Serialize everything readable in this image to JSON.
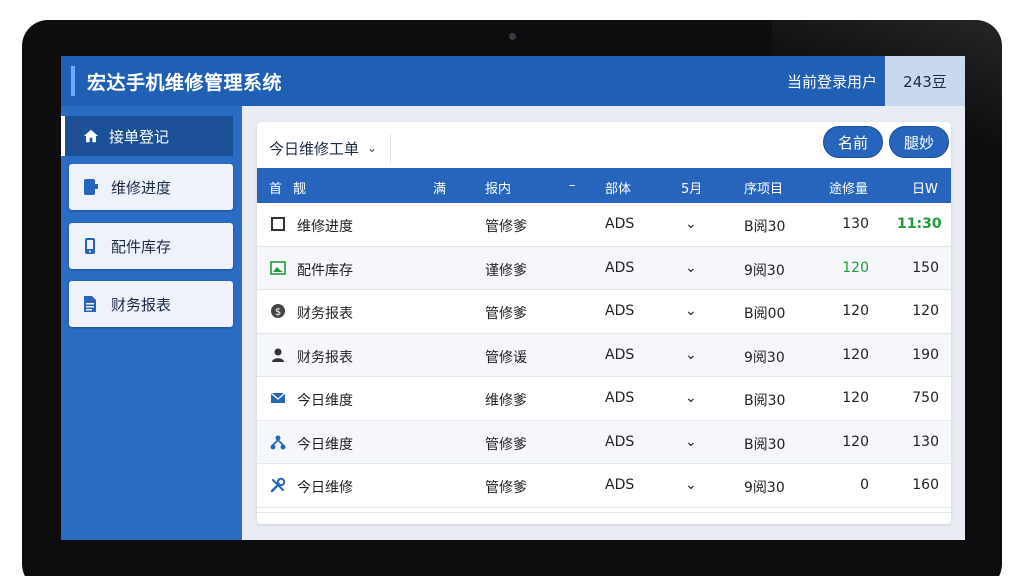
{
  "app": {
    "title": "宏达手机维修管理系统",
    "user_label": "当前登录用户",
    "user_value": "243豆"
  },
  "sidebar": {
    "items": [
      {
        "label": "接单登记",
        "icon": "home-icon"
      },
      {
        "label": "维修进度",
        "icon": "phone-icon"
      },
      {
        "label": "配件库存",
        "icon": "mobile-icon"
      },
      {
        "label": "财务报表",
        "icon": "document-icon"
      }
    ]
  },
  "toolbar": {
    "dropdown_value": "今日维修工单",
    "button_1": "名前",
    "button_2": "腿妙"
  },
  "table": {
    "headers": [
      "首",
      "靓",
      "满",
      "报内",
      "–",
      "部体",
      "5月",
      "序项目",
      "途修量",
      "日W"
    ],
    "rows": [
      {
        "icon": "square-icon",
        "name": "维修进度",
        "col3": "管修爹",
        "col4": "ADS",
        "col5": "⌄",
        "col6": "B阅30",
        "col7": "130",
        "col8": "11:30"
      },
      {
        "icon": "image-icon",
        "name": "配件库存",
        "col3": "谨修爹",
        "col4": "ADS",
        "col5": "⌄",
        "col6": "9阅30",
        "col7": "120",
        "col8": "150"
      },
      {
        "icon": "coin-icon",
        "name": "财务报表",
        "col3": "管修爹",
        "col4": "ADS",
        "col5": "⌄",
        "col6": "B阅00",
        "col7": "120",
        "col8": "120"
      },
      {
        "icon": "user-icon",
        "name": "财务报表",
        "col3": "管修谖",
        "col4": "ADS",
        "col5": "⌄",
        "col6": "9阅30",
        "col7": "120",
        "col8": "190"
      },
      {
        "icon": "mail-icon",
        "name": "今日维度",
        "col3": "维修爹",
        "col4": "ADS",
        "col5": "⌄",
        "col6": "B阅30",
        "col7": "120",
        "col8": "750"
      },
      {
        "icon": "network-icon",
        "name": "今日维度",
        "col3": "管修爹",
        "col4": "ADS",
        "col5": "⌄",
        "col6": "B阅30",
        "col7": "120",
        "col8": "130"
      },
      {
        "icon": "tools-icon",
        "name": "今日维修",
        "col3": "管修爹",
        "col4": "ADS",
        "col5": "⌄",
        "col6": "9阅30",
        "col7": "0",
        "col8": "160"
      }
    ]
  },
  "colors": {
    "header": "#1f5fb4",
    "sidebar": "#2a6bc3",
    "accent_green": "#1f9d3a"
  }
}
